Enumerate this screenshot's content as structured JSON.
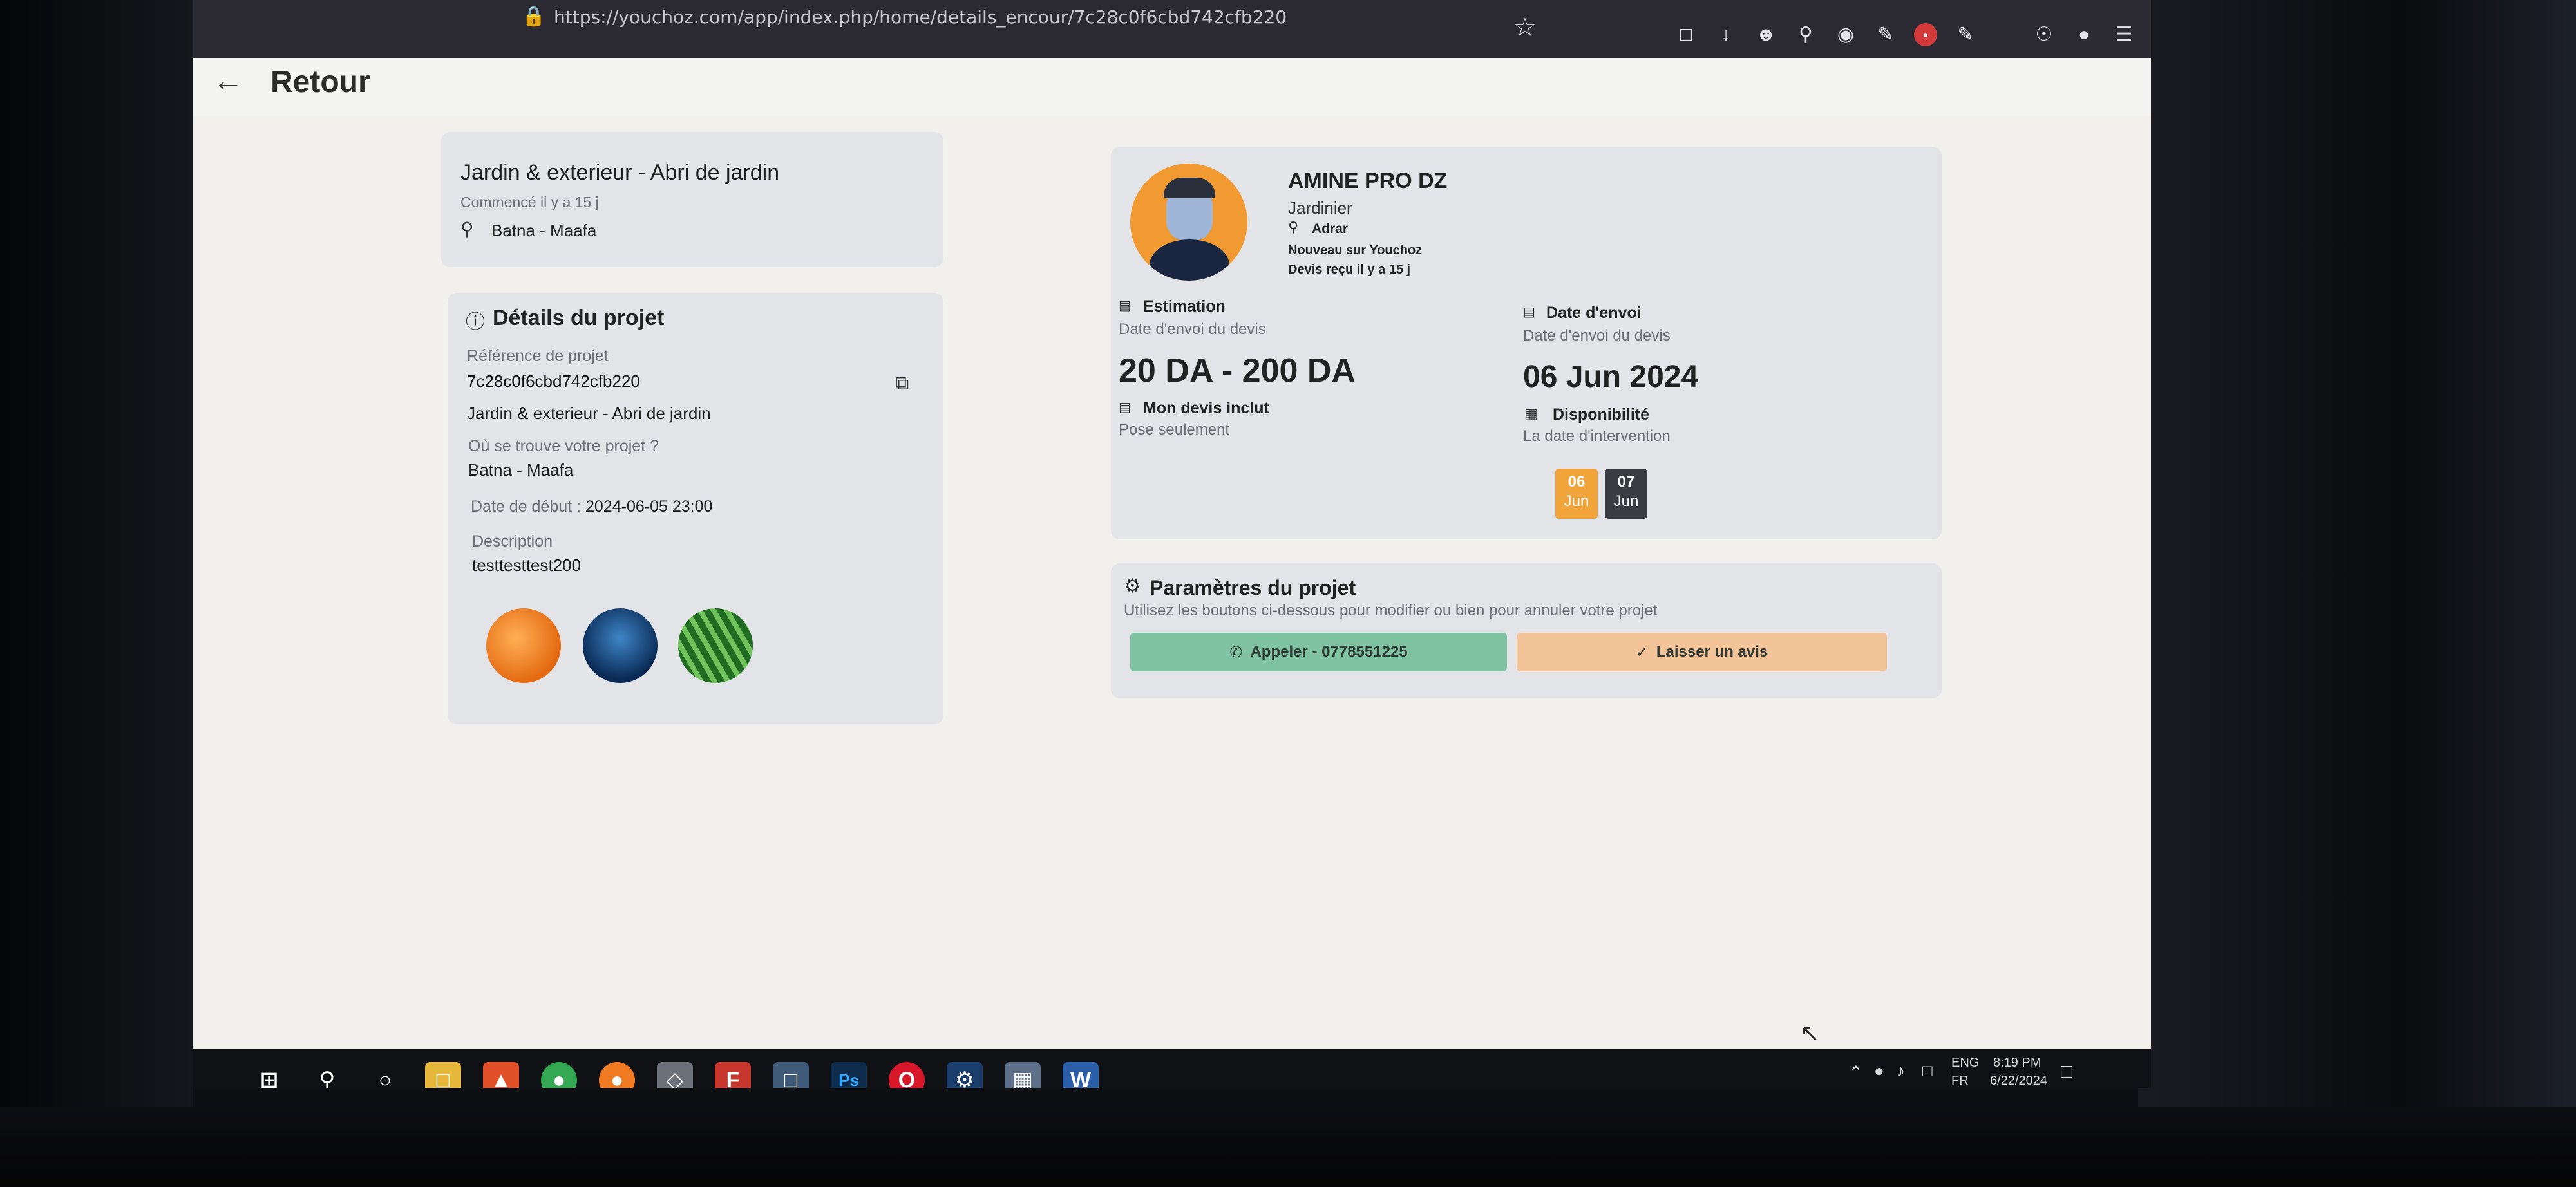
{
  "browser": {
    "url": "https://youchoz.com/app/index.php/home/details_encour/7c28c0f6cbd742cfb220"
  },
  "header": {
    "back_label": "Retour"
  },
  "project_summary": {
    "title": "Jardin & exterieur - Abri de jardin",
    "started": "Commencé il y a 15 j",
    "location": "Batna - Maafa"
  },
  "project_details": {
    "heading": "Détails du projet",
    "ref_label": "Référence de projet",
    "ref_value": "7c28c0f6cbd742cfb220",
    "category": "Jardin & exterieur - Abri de jardin",
    "where_label": "Où se trouve votre projet ?",
    "where_value": "Batna - Maafa",
    "start_label": "Date de début :",
    "start_value": "2024-06-05 23:00",
    "desc_label": "Description",
    "desc_value": "testtesttest200"
  },
  "provider": {
    "name": "AMINE PRO DZ",
    "role": "Jardinier",
    "city": "Adrar",
    "status": "Nouveau sur Youchoz",
    "quote_received": "Devis reçu il y a 15 j"
  },
  "quote": {
    "estimation_label": "Estimation",
    "estimation_sub": "Date d'envoi du devis",
    "price": "20 DA - 200 DA",
    "includes_label": "Mon devis inclut",
    "includes_value": "Pose seulement",
    "sent_label": "Date d'envoi",
    "sent_sub": "Date d'envoi du devis",
    "sent_value": "06 Jun 2024",
    "avail_label": "Disponibilité",
    "avail_sub": "La date d'intervention",
    "dates": [
      {
        "day": "06",
        "month": "Jun"
      },
      {
        "day": "07",
        "month": "Jun"
      }
    ]
  },
  "settings": {
    "heading": "Paramètres du projet",
    "hint": "Utilisez les boutons ci-dessous pour modifier ou bien pour annuler votre projet",
    "call_label": "Appeler - 0778551225",
    "review_label": "Laisser un avis"
  },
  "tray": {
    "lang1": "ENG",
    "lang2": "FR",
    "time": "8:19 PM",
    "date": "6/22/2024"
  },
  "colors": {
    "accent_orange": "#f2a23a",
    "call_green": "#7fc3a2",
    "review_orange": "#f3c39a",
    "card_gray": "#e2e4e8"
  }
}
